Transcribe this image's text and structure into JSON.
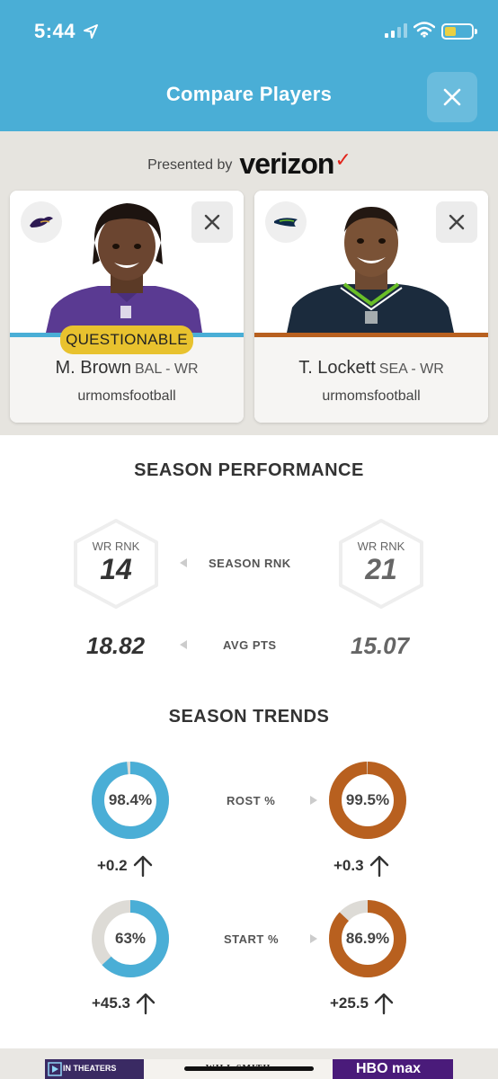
{
  "status_bar": {
    "time": "5:44"
  },
  "header": {
    "title": "Compare Players",
    "close_icon": "close-icon"
  },
  "sponsor": {
    "label": "Presented by",
    "brand": "verizon",
    "check": "✓",
    "check_color": "#e2231a"
  },
  "colors": {
    "accent": "#4aaed6",
    "left_team": "#4aaed6",
    "right_team": "#b8601f",
    "ring_track": "#dddbd6"
  },
  "players": [
    {
      "name": "M. Brown",
      "team_pos": "BAL - WR",
      "owner": "urmomsfootball",
      "status": "QUESTIONABLE",
      "team_icon": "ravens-logo-icon"
    },
    {
      "name": "T. Lockett",
      "team_pos": "SEA - WR",
      "owner": "urmomsfootball",
      "status": "",
      "team_icon": "seahawks-logo-icon"
    }
  ],
  "season_performance": {
    "title": "SEASON PERFORMANCE",
    "rank_label": "SEASON RNK",
    "left_rank_pos": "WR RNK",
    "left_rank": "14",
    "right_rank_pos": "WR RNK",
    "right_rank": "21",
    "avg_label": "AVG PTS",
    "left_avg": "18.82",
    "right_avg": "15.07"
  },
  "season_trends": {
    "title": "SEASON TRENDS",
    "rost_label": "ROST %",
    "left_rost": "98.4%",
    "left_rost_value": 98.4,
    "left_rost_delta": "+0.2",
    "right_rost": "99.5%",
    "right_rost_value": 99.5,
    "right_rost_delta": "+0.3",
    "start_label": "START %",
    "left_start": "63%",
    "left_start_value": 63,
    "left_start_delta": "+45.3",
    "right_start": "86.9%",
    "right_start_value": 86.9,
    "right_start_delta": "+25.5"
  },
  "ad": {
    "left_text": "IN THEATERS",
    "mid_text": "WILL SMITH",
    "right_text": "HBO max"
  }
}
